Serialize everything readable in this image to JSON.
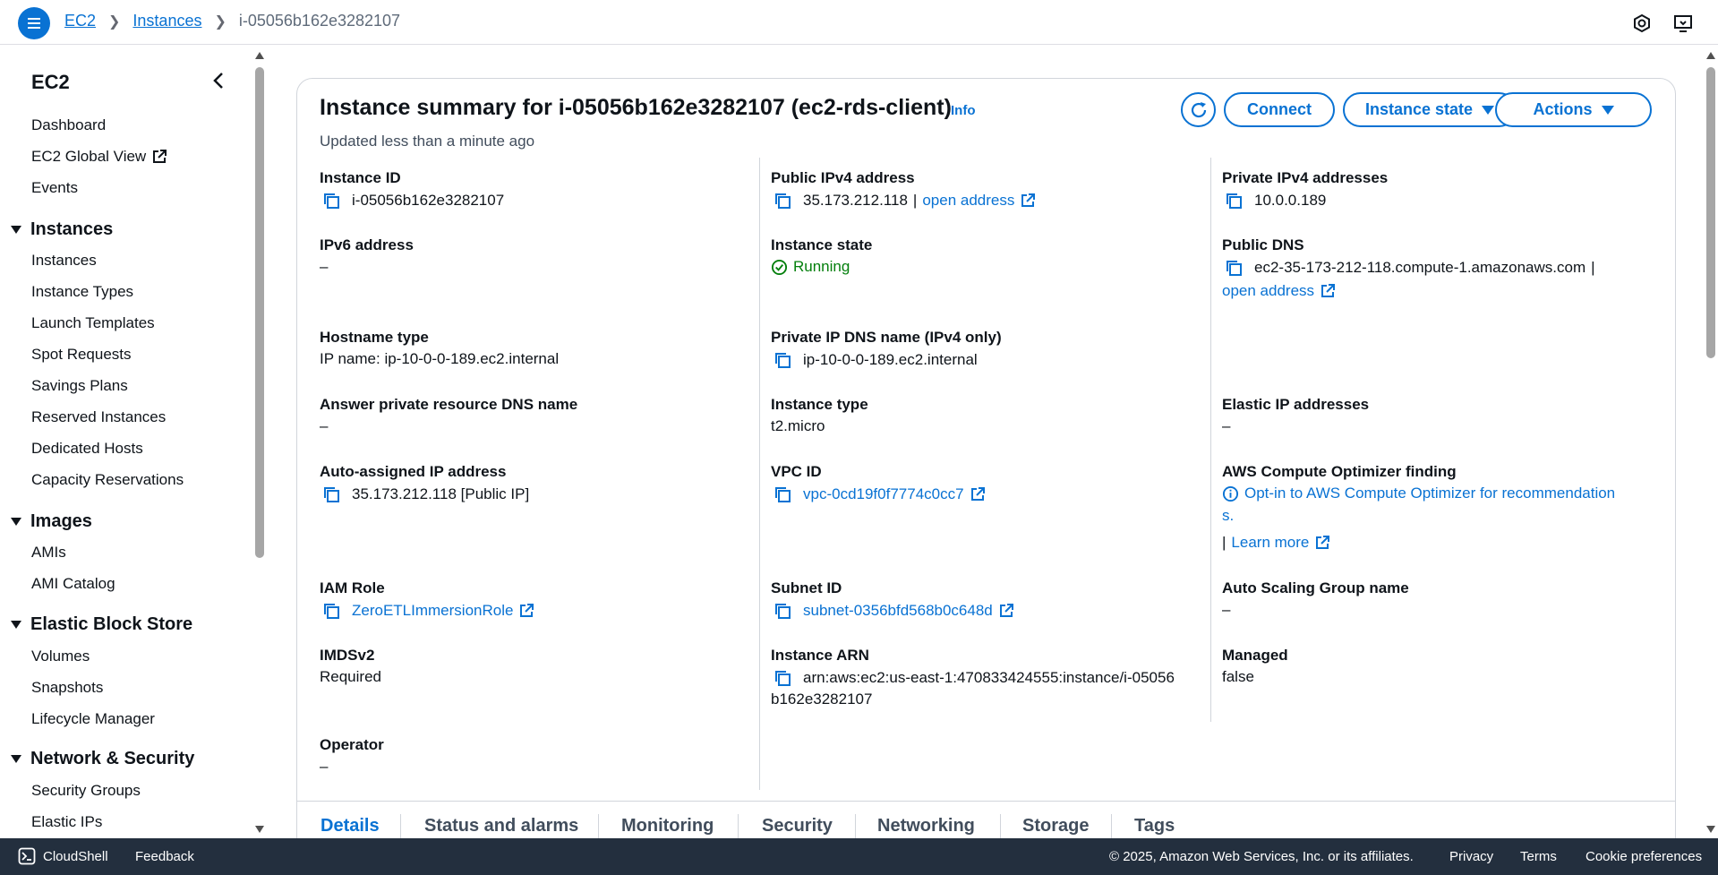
{
  "breadcrumb": {
    "root": "EC2",
    "parent": "Instances",
    "current": "i-05056b162e3282107"
  },
  "sidebar": {
    "title": "EC2",
    "top_items": [
      {
        "label": "Dashboard"
      },
      {
        "label": "EC2 Global View"
      },
      {
        "label": "Events"
      }
    ],
    "sections": [
      {
        "label": "Instances",
        "items": [
          "Instances",
          "Instance Types",
          "Launch Templates",
          "Spot Requests",
          "Savings Plans",
          "Reserved Instances",
          "Dedicated Hosts",
          "Capacity Reservations"
        ]
      },
      {
        "label": "Images",
        "items": [
          "AMIs",
          "AMI Catalog"
        ]
      },
      {
        "label": "Elastic Block Store",
        "items": [
          "Volumes",
          "Snapshots",
          "Lifecycle Manager"
        ]
      },
      {
        "label": "Network & Security",
        "items": [
          "Security Groups",
          "Elastic IPs"
        ]
      }
    ]
  },
  "summary": {
    "title": "Instance summary for i-05056b162e3282107 (ec2-rds-client)",
    "info": "Info",
    "updated": "Updated less than a minute ago",
    "buttons": {
      "connect": "Connect",
      "instance_state": "Instance state",
      "actions": "Actions"
    }
  },
  "fields": {
    "instance_id": {
      "label": "Instance ID",
      "value": "i-05056b162e3282107"
    },
    "public_ipv4": {
      "label": "Public IPv4 address",
      "value": "35.173.212.118",
      "sep": "|",
      "link": "open address"
    },
    "private_ipv4": {
      "label": "Private IPv4 addresses",
      "value": "10.0.0.189"
    },
    "ipv6": {
      "label": "IPv6 address",
      "value": "–"
    },
    "instance_state": {
      "label": "Instance state",
      "value": "Running"
    },
    "public_dns": {
      "label": "Public DNS",
      "value": "ec2-35-173-212-118.compute-1.amazonaws.com",
      "sep": "|",
      "link": "open address"
    },
    "hostname_type": {
      "label": "Hostname type",
      "value": "IP name: ip-10-0-0-189.ec2.internal"
    },
    "private_dns": {
      "label": "Private IP DNS name (IPv4 only)",
      "value": "ip-10-0-0-189.ec2.internal"
    },
    "answer_dns": {
      "label": "Answer private resource DNS name",
      "value": "–"
    },
    "instance_type": {
      "label": "Instance type",
      "value": "t2.micro"
    },
    "elastic_ip": {
      "label": "Elastic IP addresses",
      "value": "–"
    },
    "auto_ip": {
      "label": "Auto-assigned IP address",
      "value": "35.173.212.118 [Public IP]"
    },
    "vpc_id": {
      "label": "VPC ID",
      "value": "vpc-0cd19f0f7774c0cc7"
    },
    "optimizer": {
      "label": "AWS Compute Optimizer finding",
      "line1": "Opt-in to AWS Compute Optimizer for recommendation",
      "line2": "s.",
      "sep": "|",
      "link": "Learn more"
    },
    "iam_role": {
      "label": "IAM Role",
      "value": "ZeroETLImmersionRole"
    },
    "subnet_id": {
      "label": "Subnet ID",
      "value": "subnet-0356bfd568b0c648d"
    },
    "asg_name": {
      "label": "Auto Scaling Group name",
      "value": "–"
    },
    "imdsv2": {
      "label": "IMDSv2",
      "value": "Required"
    },
    "instance_arn": {
      "label": "Instance ARN",
      "line1": "arn:aws:ec2:us-east-1:470833424555:instance/i-05056",
      "line2": "b162e3282107"
    },
    "managed": {
      "label": "Managed",
      "value": "false"
    },
    "operator": {
      "label": "Operator",
      "value": "–"
    }
  },
  "tabs": [
    "Details",
    "Status and alarms",
    "Monitoring",
    "Security",
    "Networking",
    "Storage",
    "Tags"
  ],
  "footer": {
    "cloudshell": "CloudShell",
    "feedback": "Feedback",
    "copyright": "© 2025, Amazon Web Services, Inc. or its affiliates.",
    "privacy": "Privacy",
    "terms": "Terms",
    "cookies": "Cookie preferences"
  },
  "colors": {
    "accent": "#0972d3",
    "success": "#037f0c",
    "footer_bg": "#232f3e"
  }
}
